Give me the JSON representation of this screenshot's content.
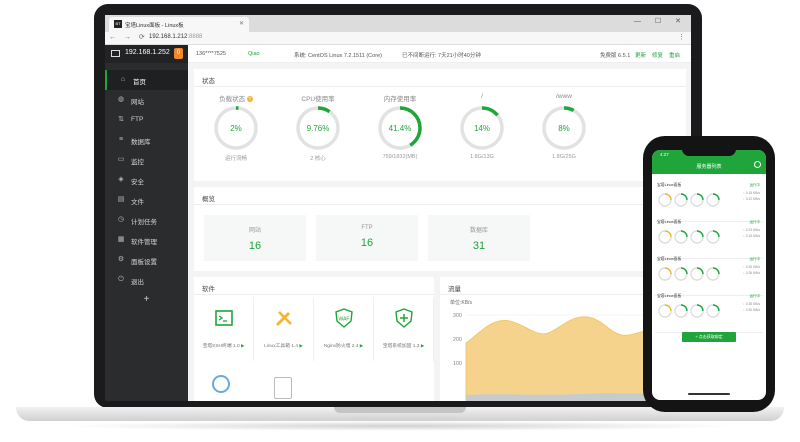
{
  "browser": {
    "tab_title": "宝塔Linux面板 - Linux板",
    "url_host": "192.168.1.212",
    "url_port": ":8888",
    "window_controls": "— ☐ ✕"
  },
  "sidebar": {
    "host_ip": "192.168.1.252",
    "badge": "0",
    "items": [
      {
        "label": "首页",
        "icon": "home-icon"
      },
      {
        "label": "网站",
        "icon": "globe-icon"
      },
      {
        "label": "FTP",
        "icon": "ftp-icon"
      },
      {
        "label": "数据库",
        "icon": "database-icon"
      },
      {
        "label": "监控",
        "icon": "monitor-icon"
      },
      {
        "label": "安全",
        "icon": "shield-icon"
      },
      {
        "label": "文件",
        "icon": "folder-icon"
      },
      {
        "label": "计划任务",
        "icon": "clock-icon"
      },
      {
        "label": "软件管理",
        "icon": "apps-icon"
      },
      {
        "label": "面板设置",
        "icon": "settings-icon"
      },
      {
        "label": "退出",
        "icon": "logout-icon"
      }
    ],
    "add": "+"
  },
  "topinfo": {
    "user": "136****7525",
    "qq": "Qiao",
    "system": "系统: CentOS Linux 7.2.1511 (Core)",
    "uptime": "已不间断运行: 7天21小时40分钟",
    "version": "免费版 6.5.1",
    "update": "更新",
    "fix": "修复",
    "restart": "重启"
  },
  "status": {
    "title": "状态",
    "gauges": [
      {
        "label": "负载状态",
        "value": "2%",
        "percent": 2,
        "sub": "运行流畅",
        "color": "#20a53a"
      },
      {
        "label": "CPU使用率",
        "value": "9.76%",
        "percent": 9.76,
        "sub": "2 核心",
        "color": "#20a53a"
      },
      {
        "label": "内存使用率",
        "value": "41.4%",
        "percent": 41.4,
        "sub": "759/1832(MB)",
        "color": "#20a53a"
      },
      {
        "label": "/",
        "value": "14%",
        "percent": 14,
        "sub": "1.8G/13G",
        "color": "#20a53a"
      },
      {
        "label": "/www",
        "value": "8%",
        "percent": 8,
        "sub": "1.8G/25G",
        "color": "#20a53a"
      }
    ]
  },
  "overview": {
    "title": "概览",
    "boxes": [
      {
        "label": "网站",
        "value": "16"
      },
      {
        "label": "FTP",
        "value": "16"
      },
      {
        "label": "数据库",
        "value": "31"
      }
    ]
  },
  "software": {
    "title": "软件",
    "items": [
      {
        "name": "宝塔SSH终端 1.0",
        "icon": "terminal-icon"
      },
      {
        "name": "Linux工具箱 1.4",
        "icon": "tools-icon"
      },
      {
        "name": "Nginx防火墙 2.4",
        "icon": "waf-shield-icon"
      },
      {
        "name": "宝塔系统加固 1.3",
        "icon": "plus-shield-icon"
      }
    ],
    "play": "▶"
  },
  "traffic": {
    "title": "流量",
    "unit": "单位:KB/s",
    "yticks": [
      "300",
      "200",
      "100"
    ]
  },
  "phone": {
    "time": "4:27",
    "title": "服务器列表",
    "cards": [
      {
        "name": "宝塔Linux面板",
        "status": "运行中",
        "lines": [
          "↑ 0.15 KB/s",
          "↓ 0.22 KB/s"
        ]
      },
      {
        "name": "宝塔Linux面板",
        "status": "运行中",
        "lines": [
          "↑ 0.23 KB/s",
          "↓ 0.15 KB/s"
        ]
      },
      {
        "name": "宝塔Linux面板",
        "status": "运行中",
        "lines": [
          "↑ 0.26 KB/s",
          "↓ 0.26 KB/s"
        ]
      },
      {
        "name": "宝塔Linux面板",
        "status": "运行中",
        "lines": [
          "↑ 0.35 KB/s",
          "↓ 0.30 KB/s"
        ]
      }
    ],
    "button": "+ 点击获取绑定"
  },
  "colors": {
    "accent": "#20a53a",
    "sidebar": "#2b2c2e",
    "warning": "#f0872a"
  }
}
